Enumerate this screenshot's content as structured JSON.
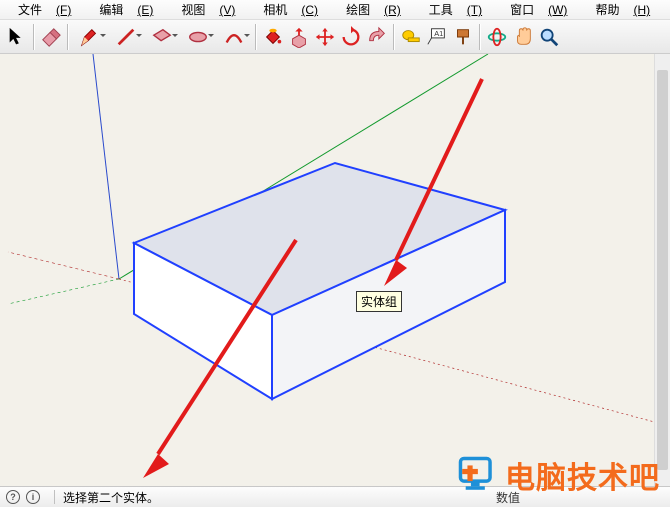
{
  "menu": {
    "file": {
      "text": "文件",
      "accel": "(F)"
    },
    "edit": {
      "text": "编辑",
      "accel": "(E)"
    },
    "view": {
      "text": "视图",
      "accel": "(V)"
    },
    "camera": {
      "text": "相机",
      "accel": "(C)"
    },
    "draw": {
      "text": "绘图",
      "accel": "(R)"
    },
    "tools": {
      "text": "工具",
      "accel": "(T)"
    },
    "window": {
      "text": "窗口",
      "accel": "(W)"
    },
    "help": {
      "text": "帮助",
      "accel": "(H)"
    }
  },
  "toolbar_icons": {
    "select": "select-arrow",
    "eraser": "eraser",
    "pencil": "pencil",
    "line": "line",
    "rect": "rectangle",
    "polygon": "polygon",
    "arc": "arc",
    "bucket": "paint-bucket",
    "pushpull": "push-pull",
    "move": "move",
    "rotate": "rotate",
    "offset": "offset",
    "tape": "tape-measure",
    "text": "text-label",
    "paint": "paint",
    "orbit": "orbit",
    "pan": "pan",
    "zoom": "zoom"
  },
  "viewport": {
    "tooltip": "实体组",
    "axes": {
      "x": "green",
      "y": "red",
      "z": "blue"
    }
  },
  "statusbar": {
    "hint": "选择第二个实体。",
    "label_numeric": "数值",
    "info_glyph": "?",
    "user_glyph": "i"
  },
  "watermark": {
    "text": "电脑技术吧"
  },
  "colors": {
    "arrow": "#e21b1b",
    "box_outline": "#2040ff",
    "box_fill_top": "#d9dde8",
    "box_fill_side": "#ffffff"
  }
}
